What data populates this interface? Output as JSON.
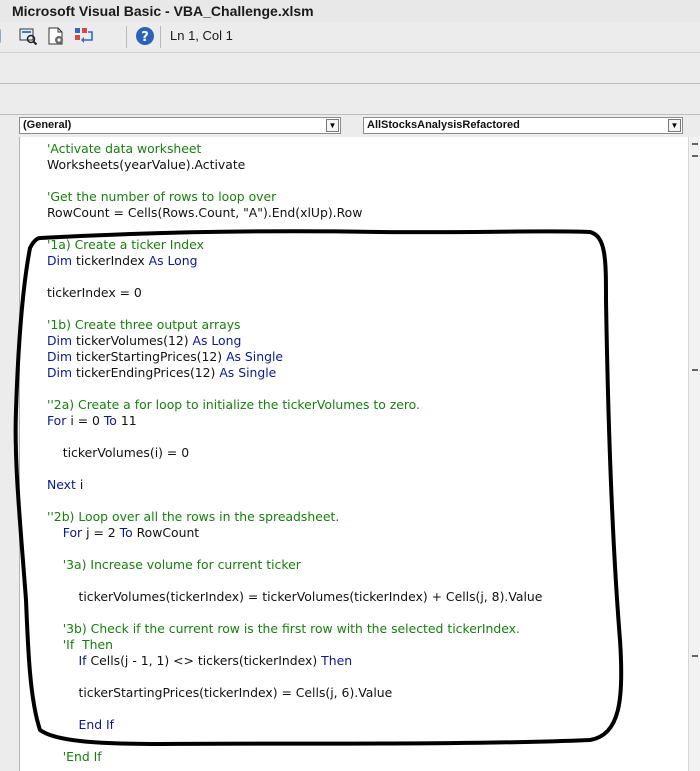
{
  "window": {
    "title": "Microsoft Visual Basic - VBA_Challenge.xlsm"
  },
  "toolbar": {
    "icons": [
      "object-browser-icon",
      "toolbox-icon",
      "tab-order-icon",
      "help-icon"
    ],
    "position": "Ln 1, Col 1"
  },
  "module": {
    "object_dropdown": "(General)",
    "procedure_dropdown": "AllStocksAnalysisRefactored"
  },
  "code_lines": [
    [
      {
        "t": "'Activate data worksheet",
        "c": "cm"
      }
    ],
    [
      {
        "t": "Worksheets(yearValue).Activate"
      }
    ],
    [],
    [
      {
        "t": "'Get the number of rows to loop over",
        "c": "cm"
      }
    ],
    [
      {
        "t": "RowCount = Cells(Rows.Count, \"A\").End(xlUp).Row"
      }
    ],
    [],
    [
      {
        "t": "'1a) Create a ticker Index",
        "c": "cm"
      }
    ],
    [
      {
        "t": "Dim",
        "c": "kw"
      },
      {
        "t": " tickerIndex "
      },
      {
        "t": "As Long",
        "c": "kw"
      }
    ],
    [],
    [
      {
        "t": "tickerIndex = 0"
      }
    ],
    [],
    [
      {
        "t": "'1b) Create three output arrays",
        "c": "cm"
      }
    ],
    [
      {
        "t": "Dim",
        "c": "kw"
      },
      {
        "t": " tickerVolumes(12) "
      },
      {
        "t": "As Long",
        "c": "kw"
      }
    ],
    [
      {
        "t": "Dim",
        "c": "kw"
      },
      {
        "t": " tickerStartingPrices(12) "
      },
      {
        "t": "As Single",
        "c": "kw"
      }
    ],
    [
      {
        "t": "Dim",
        "c": "kw"
      },
      {
        "t": " tickerEndingPrices(12) "
      },
      {
        "t": "As Single",
        "c": "kw"
      }
    ],
    [],
    [
      {
        "t": "''2a) Create a for loop to initialize the tickerVolumes to zero.",
        "c": "cm"
      }
    ],
    [
      {
        "t": "For",
        "c": "kw"
      },
      {
        "t": " i = 0 "
      },
      {
        "t": "To",
        "c": "kw"
      },
      {
        "t": " 11"
      }
    ],
    [],
    [
      {
        "t": "    tickerVolumes(i) = 0"
      }
    ],
    [],
    [
      {
        "t": "Next",
        "c": "kw"
      },
      {
        "t": " i"
      }
    ],
    [],
    [
      {
        "t": "''2b) Loop over all the rows in the spreadsheet.",
        "c": "cm"
      }
    ],
    [
      {
        "t": "    "
      },
      {
        "t": "For",
        "c": "kw"
      },
      {
        "t": " j = 2 "
      },
      {
        "t": "To",
        "c": "kw"
      },
      {
        "t": " RowCount"
      }
    ],
    [],
    [
      {
        "t": "    '3a) Increase volume for current ticker",
        "c": "cm"
      }
    ],
    [],
    [
      {
        "t": "        tickerVolumes(tickerIndex) = tickerVolumes(tickerIndex) + Cells(j, 8).Value"
      }
    ],
    [],
    [
      {
        "t": "    '3b) Check if the current row is the first row with the selected tickerIndex.",
        "c": "cm"
      }
    ],
    [
      {
        "t": "    'If  Then",
        "c": "cm"
      }
    ],
    [
      {
        "t": "        "
      },
      {
        "t": "If",
        "c": "kw"
      },
      {
        "t": " Cells(j - 1, 1) <> tickers(tickerIndex) "
      },
      {
        "t": "Then",
        "c": "kw"
      }
    ],
    [],
    [
      {
        "t": "        tickerStartingPrices(tickerIndex) = Cells(j, 6).Value"
      }
    ],
    [],
    [
      {
        "t": "        "
      },
      {
        "t": "End If",
        "c": "kw"
      }
    ],
    [],
    [
      {
        "t": "    'End If",
        "c": "cm"
      }
    ]
  ],
  "colors": {
    "keyword": "#0a1a8c",
    "comment": "#17800d",
    "text": "#111111",
    "annotation": "#000000"
  }
}
